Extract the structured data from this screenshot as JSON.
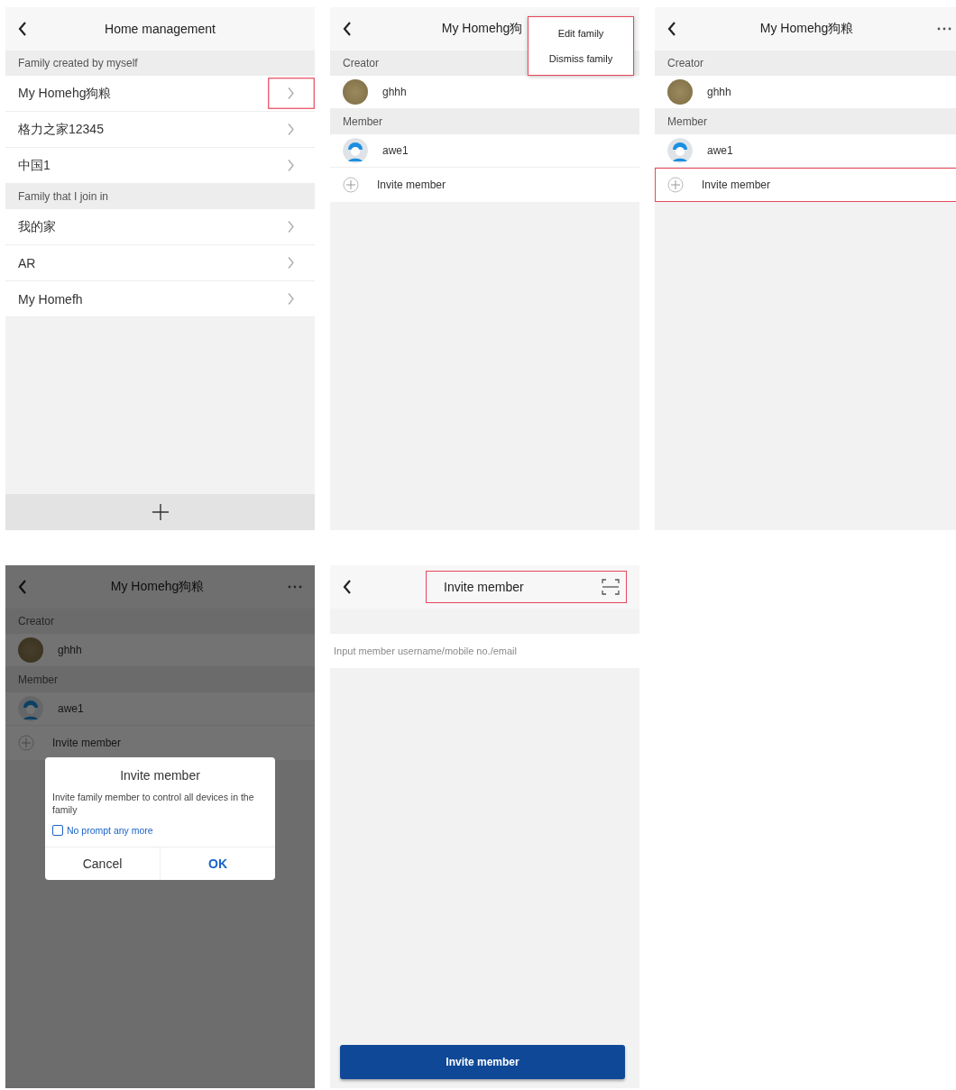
{
  "screens": [
    {
      "kind": "list",
      "title": "Home management",
      "sections": [
        {
          "heading": "Family created by myself",
          "items": [
            {
              "label": "My Homehg狗粮",
              "highlighted": true
            },
            {
              "label": "格力之家12345",
              "highlighted": false
            },
            {
              "label": "中国1",
              "highlighted": false
            }
          ]
        },
        {
          "heading": "Family that I join in",
          "items": [
            {
              "label": "我的家",
              "highlighted": false
            },
            {
              "label": "AR",
              "highlighted": false
            },
            {
              "label": "My Homefh",
              "highlighted": false
            }
          ]
        }
      ]
    },
    {
      "kind": "members",
      "title": "My Homehg狗",
      "menu": {
        "highlighted": true,
        "items": [
          "Edit family",
          "Dismiss family"
        ]
      },
      "groups": [
        {
          "heading": "Creator",
          "people": [
            {
              "name": "ghhh",
              "kind": "photo"
            }
          ]
        },
        {
          "heading": "Member",
          "people": [
            {
              "name": "awe1",
              "kind": "default"
            }
          ]
        }
      ],
      "invite": {
        "label": "Invite member",
        "highlighted": false
      }
    },
    {
      "kind": "members",
      "title": "My Homehg狗粮",
      "more": true,
      "groups": [
        {
          "heading": "Creator",
          "people": [
            {
              "name": "ghhh",
              "kind": "photo"
            }
          ]
        },
        {
          "heading": "Member",
          "people": [
            {
              "name": "awe1",
              "kind": "default"
            }
          ]
        }
      ],
      "invite": {
        "label": "Invite member",
        "highlighted": true
      }
    },
    {
      "kind": "members",
      "title": "My Homehg狗粮",
      "more": true,
      "dimmed": true,
      "groups": [
        {
          "heading": "Creator",
          "people": [
            {
              "name": "ghhh",
              "kind": "photo"
            }
          ]
        },
        {
          "heading": "Member",
          "people": [
            {
              "name": "awe1",
              "kind": "default"
            }
          ]
        }
      ],
      "invite": {
        "label": "Invite member",
        "highlighted": false
      },
      "dialog": {
        "title": "Invite member",
        "message": "Invite family member to control all devices in the family",
        "checkbox": {
          "label": "No prompt any more",
          "checked": false
        },
        "buttons": [
          "Cancel",
          "OK"
        ]
      }
    },
    {
      "kind": "invite",
      "title": "Invite member",
      "header_highlighted": true,
      "field": {
        "placeholder": "Input member username/mobile no./email"
      },
      "button": "Invite member"
    }
  ]
}
